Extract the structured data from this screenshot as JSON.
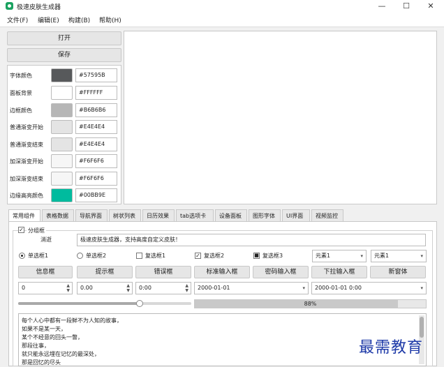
{
  "window": {
    "title": "极速皮肤生成器",
    "min": "—",
    "max": "☐",
    "close": "✕"
  },
  "menu": [
    "文件(F)",
    "编辑(E)",
    "构建(B)",
    "帮助(H)"
  ],
  "actions": {
    "open": "打开",
    "save": "保存"
  },
  "colors": [
    {
      "label": "字体颜色",
      "hex": "#57595B",
      "swatch": "#57595B"
    },
    {
      "label": "面板背景",
      "hex": "#FFFFFF",
      "swatch": "#FFFFFF"
    },
    {
      "label": "边框颜色",
      "hex": "#B6B6B6",
      "swatch": "#B6B6B6"
    },
    {
      "label": "普通渐变开始",
      "hex": "#E4E4E4",
      "swatch": "#E4E4E4"
    },
    {
      "label": "普通渐变结束",
      "hex": "#E4E4E4",
      "swatch": "#E4E4E4"
    },
    {
      "label": "加深渐变开始",
      "hex": "#F6F6F6",
      "swatch": "#F6F6F6"
    },
    {
      "label": "加深渐变结束",
      "hex": "#F6F6F6",
      "swatch": "#F6F6F6"
    },
    {
      "label": "边缘高亮颜色",
      "hex": "#00BB9E",
      "swatch": "#00BB9E"
    }
  ],
  "tabs": [
    "常用组件",
    "表格数据",
    "导航界面",
    "树状列表",
    "日历效果",
    "tab选项卡",
    "设备面板",
    "图形字体",
    "UI界面",
    "视频监控"
  ],
  "group": {
    "title": "分组框",
    "checkbox_mark": "✓",
    "prompt_label": "消逝",
    "prompt_value": "极速皮肤生成器，支持高度自定义皮肤！"
  },
  "options": {
    "radio1": "单选框1",
    "radio2": "单选框2",
    "check1": "复选框1",
    "check2": "复选框2",
    "check3": "复选框3",
    "check_mark": "✓",
    "partial_mark": "■",
    "combo1": "元素1",
    "combo2": "元素1"
  },
  "buttons": [
    "信息框",
    "提示框",
    "错误框",
    "标准输入框",
    "密码输入框",
    "下拉输入框",
    "新窗体"
  ],
  "inputs": {
    "int_spin": "0",
    "dbl_spin1": "0.00",
    "time_spin": "0:00",
    "date": "2000-01-01",
    "datetime": "2000-01-01 0:00"
  },
  "slider": {
    "value": 0.7
  },
  "progress": {
    "value": 0.88,
    "text": "88%"
  },
  "poem": [
    "每个人心中都有一段鲜不为人知的故事，",
    "如果不是某一天，",
    "某个不经意的回头一瞥，",
    "那段往事，",
    "就只能永远埋在记忆的最深处，",
    "那是回忆的尽头"
  ],
  "watermark": "最需教育"
}
